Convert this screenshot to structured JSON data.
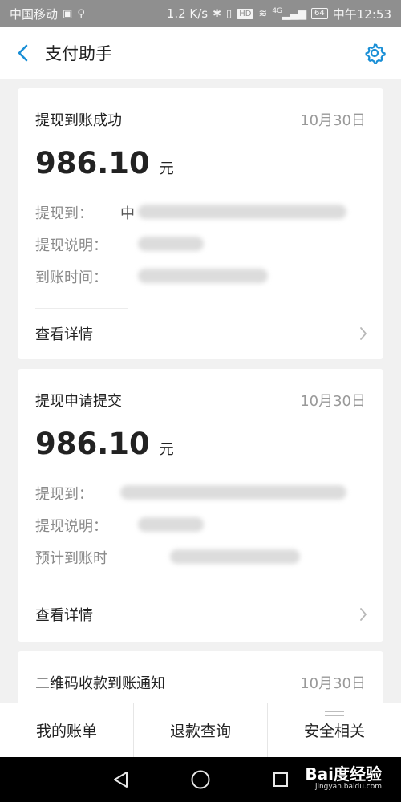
{
  "status_bar": {
    "carrier": "中国移动",
    "speed": "1.2 K/s",
    "hd_badge": "HD",
    "network_badge": "4G",
    "battery": "64",
    "time": "中午12:53"
  },
  "header": {
    "title": "支付助手"
  },
  "cards": [
    {
      "title": "提现到账成功",
      "date": "10月30日",
      "amount": "986.10",
      "unit": "元",
      "fields": [
        {
          "label": "提现到：",
          "visible_value": "中"
        },
        {
          "label": "提现说明：",
          "visible_value": ""
        },
        {
          "label": "到账时间：",
          "visible_value": ""
        }
      ],
      "details_label": "查看详情"
    },
    {
      "title": "提现申请提交",
      "date": "10月30日",
      "amount": "986.10",
      "unit": "元",
      "fields": [
        {
          "label": "提现到：",
          "visible_value": ""
        },
        {
          "label": "提现说明：",
          "visible_value": ""
        },
        {
          "label": "预计到账时",
          "visible_value": ""
        }
      ],
      "details_label": "查看详情"
    },
    {
      "title": "二维码收款到账通知",
      "date": "10月30日"
    }
  ],
  "tabs": [
    {
      "label": "我的账单"
    },
    {
      "label": "退款查询"
    },
    {
      "label": "安全相关"
    }
  ],
  "watermark": {
    "brand": "Bai度经验",
    "site": "jingyan.baidu.com"
  },
  "colors": {
    "accent": "#1a8fd6",
    "status_bar": "#8f8f8f",
    "background": "#f1f1f1"
  },
  "icons": {
    "back": "back-chevron-icon",
    "settings": "gear-icon",
    "details": "chevron-right-icon"
  }
}
